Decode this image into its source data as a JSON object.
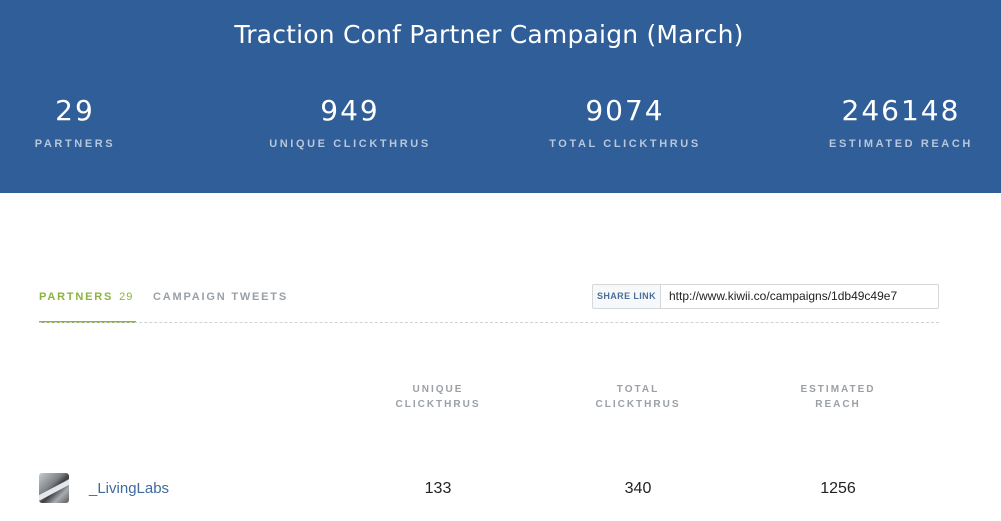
{
  "header": {
    "title": "Traction Conf Partner Campaign (March)",
    "stats": [
      {
        "value": "29",
        "label": "PARTNERS"
      },
      {
        "value": "949",
        "label": "UNIQUE CLICKTHRUS"
      },
      {
        "value": "9074",
        "label": "TOTAL CLICKTHRUS"
      },
      {
        "value": "246148",
        "label": "ESTIMATED REACH"
      }
    ]
  },
  "tabs": {
    "partners_label": "PARTNERS",
    "partners_count": "29",
    "tweets_label": "CAMPAIGN TWEETS"
  },
  "share": {
    "label": "SHARE LINK",
    "url": "http://www.kiwii.co/campaigns/1db49c49e7"
  },
  "table": {
    "columns": [
      [
        "UNIQUE",
        "CLICKTHRUS"
      ],
      [
        "TOTAL",
        "CLICKTHRUS"
      ],
      [
        "ESTIMATED",
        "REACH"
      ]
    ],
    "rows": [
      {
        "name": "_LivingLabs",
        "unique": "133",
        "total": "340",
        "reach": "1256"
      }
    ]
  },
  "colors": {
    "header_bg": "#2f5e98",
    "accent_green": "#8bb33e",
    "link_blue": "#3f6a9c"
  },
  "icons": {
    "avatar": "partner-avatar"
  }
}
